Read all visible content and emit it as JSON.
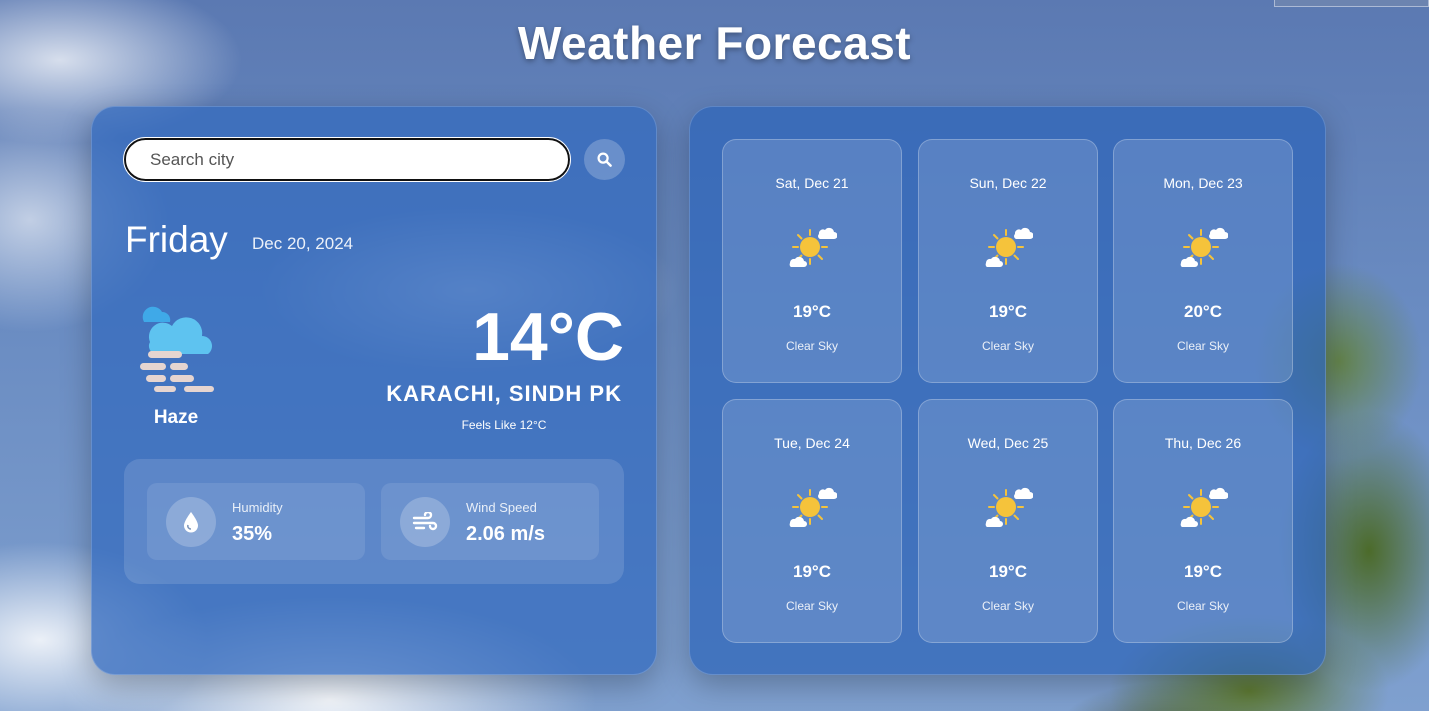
{
  "page": {
    "title": "Weather Forecast"
  },
  "search": {
    "placeholder": "Search city",
    "button_icon": "search-icon"
  },
  "current": {
    "day": "Friday",
    "date": "Dec 20, 2024",
    "temperature": "14°C",
    "location": "KARACHI, SINDH PK",
    "feels_like": "Feels Like 12°C",
    "condition": "Haze",
    "condition_icon": "haze-icon"
  },
  "stats": {
    "humidity": {
      "label": "Humidity",
      "value": "35%",
      "icon": "water-drop-icon"
    },
    "wind": {
      "label": "Wind Speed",
      "value": "2.06 m/s",
      "icon": "wind-icon"
    }
  },
  "forecast": [
    {
      "date": "Sat, Dec 21",
      "temp": "19°C",
      "condition": "Clear Sky",
      "icon": "sun-cloud-icon"
    },
    {
      "date": "Sun, Dec 22",
      "temp": "19°C",
      "condition": "Clear Sky",
      "icon": "sun-cloud-icon"
    },
    {
      "date": "Mon, Dec 23",
      "temp": "20°C",
      "condition": "Clear Sky",
      "icon": "sun-cloud-icon"
    },
    {
      "date": "Tue, Dec 24",
      "temp": "19°C",
      "condition": "Clear Sky",
      "icon": "sun-cloud-icon"
    },
    {
      "date": "Wed, Dec 25",
      "temp": "19°C",
      "condition": "Clear Sky",
      "icon": "sun-cloud-icon"
    },
    {
      "date": "Thu, Dec 26",
      "temp": "19°C",
      "condition": "Clear Sky",
      "icon": "sun-cloud-icon"
    }
  ],
  "colors": {
    "sun": "#f5c33b",
    "cloud_blue": "#5ec3f0",
    "haze_bars": "#e6d5d0"
  }
}
